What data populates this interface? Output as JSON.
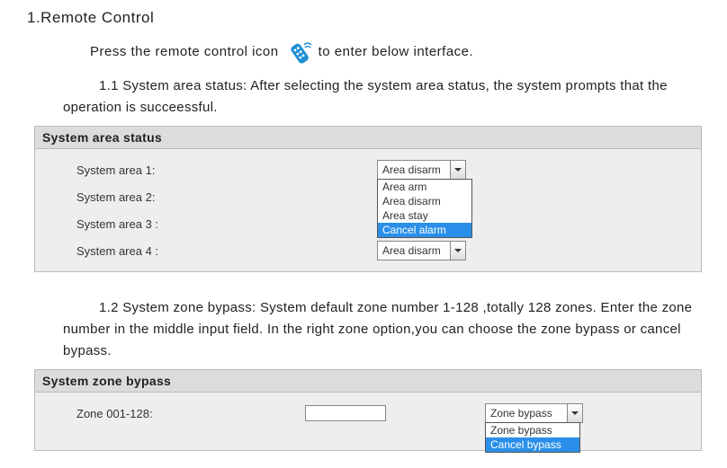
{
  "heading": "1.Remote Control",
  "intro_before": "Press the remote control icon",
  "intro_after": "to enter below interface.",
  "section11": "1.1 System area status: After selecting the system area status, the system prompts that the operation is succeessful.",
  "panel1": {
    "title": "System area status",
    "rows": [
      {
        "label": "System area 1:",
        "value": "Area disarm"
      },
      {
        "label": "System area 2:",
        "value": ""
      },
      {
        "label": "System area 3 :",
        "value": ""
      },
      {
        "label": "System area 4 :",
        "value": "Area disarm"
      }
    ],
    "open_options": [
      "Area arm",
      "Area disarm",
      "Area stay",
      "Cancel alarm"
    ],
    "open_selected": "Cancel alarm"
  },
  "section12": "1.2 System zone bypass: System default zone number 1-128 ,totally 128 zones. Enter the zone number in the middle input field. In the right zone option,you can choose the zone bypass or cancel bypass.",
  "panel2": {
    "title": "System zone bypass",
    "row": {
      "label": "Zone 001-128:",
      "input": "",
      "value": "Zone bypass"
    },
    "open_options": [
      "Zone bypass",
      "Cancel bypass"
    ],
    "open_selected": "Cancel bypass"
  }
}
